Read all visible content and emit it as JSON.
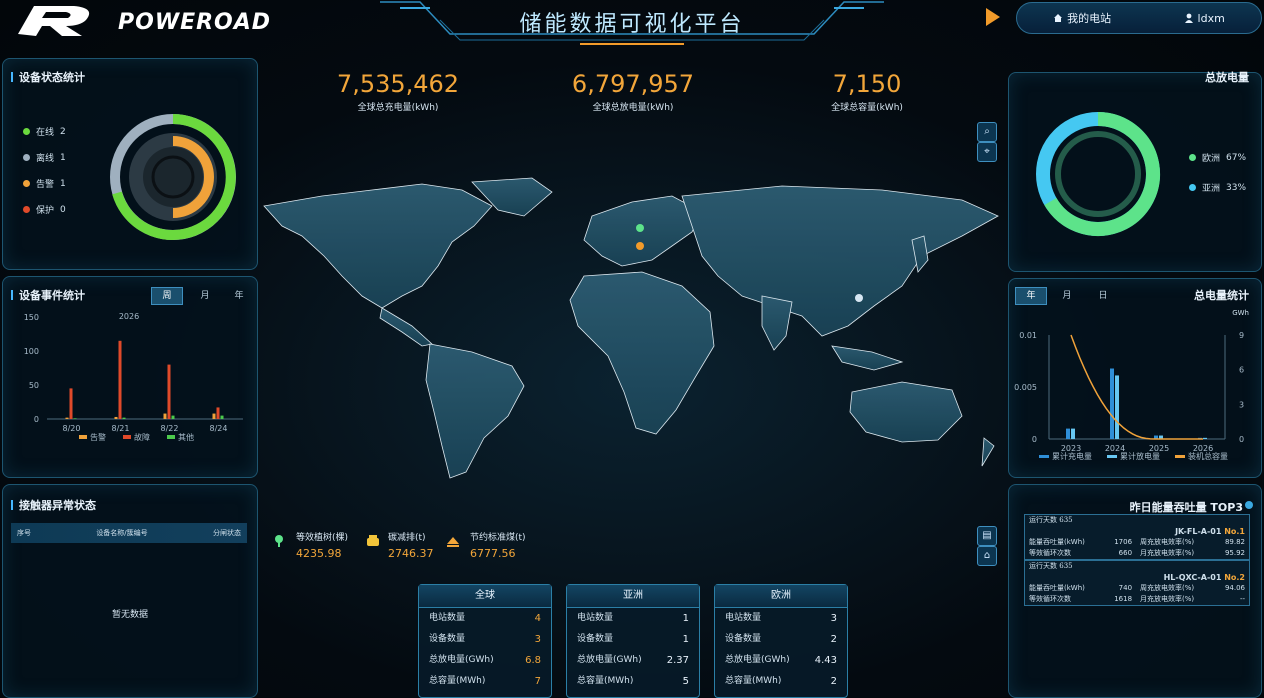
{
  "header": {
    "brand": "POWEROAD",
    "title": "储能数据可视化平台",
    "my_station": "我的电站",
    "user": "ldxm"
  },
  "device_status": {
    "title": "设备状态统计",
    "items": [
      {
        "label": "在线",
        "value": "2",
        "color": "#6bd93e"
      },
      {
        "label": "离线",
        "value": "1",
        "color": "#9fb0bf"
      },
      {
        "label": "告警",
        "value": "1",
        "color": "#f0a23a"
      },
      {
        "label": "保护",
        "value": "0",
        "color": "#e04a2a"
      }
    ]
  },
  "device_events": {
    "title": "设备事件统计",
    "tabs": [
      "周",
      "月",
      "年"
    ],
    "year": "2026"
  },
  "contactor": {
    "title": "接触器异常状态",
    "columns": [
      "序号",
      "设备名称/簇编号",
      "分闸状态"
    ],
    "empty": "暂无数据"
  },
  "kpis": [
    {
      "value": "7,535,462",
      "label": "全球总充电量(kWh)"
    },
    {
      "value": "6,797,957",
      "label": "全球总放电量(kWh)"
    },
    {
      "value": "7,150",
      "label": "全球总容量(kWh)"
    }
  ],
  "eco": [
    {
      "label": "等效植树(棵)",
      "value": "4235.98",
      "icon": "tree-icon"
    },
    {
      "label": "碳减排(t)",
      "value": "2746.37",
      "icon": "co2-icon"
    },
    {
      "label": "节约标准煤(t)",
      "value": "6777.56",
      "icon": "coal-icon"
    }
  ],
  "regions": [
    {
      "name": "全球",
      "rows": [
        {
          "label": "电站数量",
          "value": "4"
        },
        {
          "label": "设备数量",
          "value": "3"
        },
        {
          "label": "总放电量(GWh)",
          "value": "6.8"
        },
        {
          "label": "总容量(MWh)",
          "value": "7"
        }
      ]
    },
    {
      "name": "亚洲",
      "rows": [
        {
          "label": "电站数量",
          "value": "1"
        },
        {
          "label": "设备数量",
          "value": "1"
        },
        {
          "label": "总放电量(GWh)",
          "value": "2.37"
        },
        {
          "label": "总容量(MWh)",
          "value": "5"
        }
      ]
    },
    {
      "name": "欧洲",
      "rows": [
        {
          "label": "电站数量",
          "value": "3"
        },
        {
          "label": "设备数量",
          "value": "2"
        },
        {
          "label": "总放电量(GWh)",
          "value": "4.43"
        },
        {
          "label": "总容量(MWh)",
          "value": "2"
        }
      ]
    }
  ],
  "discharge_share": {
    "title": "总放电量",
    "items": [
      {
        "label": "欧洲",
        "pct": "67%",
        "color": "#5de38a"
      },
      {
        "label": "亚洲",
        "pct": "33%",
        "color": "#45c8f2"
      }
    ]
  },
  "total_energy": {
    "title": "总电量统计",
    "tabs": [
      "年",
      "月",
      "日"
    ],
    "right_unit": "GWh"
  },
  "top3": {
    "title": "昨日能量吞吐量 TOP3",
    "cards": [
      {
        "days_label": "运行天数",
        "days": "635",
        "device": "JK-FL-A-01",
        "rank": "No.1",
        "l1": "能量吞吐量(kWh)",
        "v1": "1706",
        "l2": "周充放电效率(%)",
        "v2": "89.82",
        "l3": "等效循环次数",
        "v3": "660",
        "l4": "月充放电效率(%)",
        "v4": "95.92"
      },
      {
        "days_label": "运行天数",
        "days": "635",
        "device": "HL-QXC-A-01",
        "rank": "No.2",
        "l1": "能量吞吐量(kWh)",
        "v1": "740",
        "l2": "周充放电效率(%)",
        "v2": "94.06",
        "l3": "等效循环次数",
        "v3": "1618",
        "l4": "月充放电效率(%)",
        "v4": "--"
      }
    ]
  },
  "chart_data": [
    {
      "type": "bar",
      "title": "2026",
      "categories": [
        "8/20",
        "8/21",
        "8/22",
        "8/24"
      ],
      "ylim": [
        0,
        150
      ],
      "yticks": [
        "150",
        "100",
        "50",
        "0"
      ],
      "series": [
        {
          "name": "告警",
          "values": [
            2,
            3,
            8,
            8
          ],
          "color": "#f0a23a"
        },
        {
          "name": "故障",
          "values": [
            45,
            115,
            80,
            17
          ],
          "color": "#e04a2a"
        },
        {
          "name": "其他",
          "values": [
            1,
            2,
            5,
            5
          ],
          "color": "#4cc94c"
        }
      ]
    },
    {
      "type": "bar",
      "categories": [
        "2023",
        "2024",
        "2025",
        "2026"
      ],
      "ylim_left": [
        0,
        0.01
      ],
      "ylim_right": [
        0,
        9
      ],
      "left_ticks": [
        "0.01",
        "0.005",
        "0"
      ],
      "right_ticks": [
        "9",
        "6",
        "3",
        "0"
      ],
      "series": [
        {
          "name": "累计充电量",
          "values": [
            0.9,
            6.1,
            0.3,
            0.1
          ],
          "color": "#2f8fd8"
        },
        {
          "name": "累计放电量",
          "values": [
            0.9,
            5.5,
            0.3,
            0.1
          ],
          "color": "#67c7f2"
        },
        {
          "name": "装机总容量",
          "values": [
            0.01,
            0.0005,
            0.0001,
            0.0
          ],
          "color": "#f0a23a",
          "kind": "line"
        }
      ]
    }
  ]
}
